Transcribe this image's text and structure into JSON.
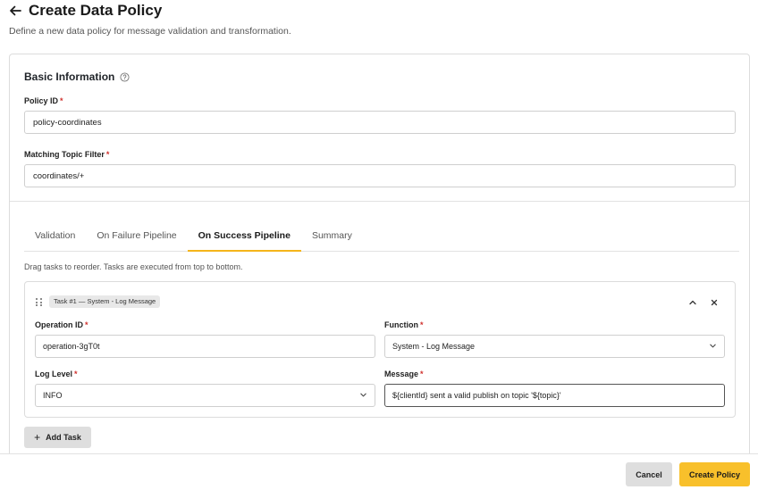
{
  "header": {
    "title": "Create Data Policy",
    "subtitle": "Define a new data policy for message validation and transformation."
  },
  "basic_info": {
    "title": "Basic Information",
    "policy_id_label": "Policy ID",
    "policy_id_value": "policy-coordinates",
    "topic_filter_label": "Matching Topic Filter",
    "topic_filter_value": "coordinates/+",
    "required_mark": "*"
  },
  "tabs": [
    {
      "label": "Validation",
      "active": false
    },
    {
      "label": "On Failure Pipeline",
      "active": false
    },
    {
      "label": "On Success Pipeline",
      "active": true
    },
    {
      "label": "Summary",
      "active": false
    }
  ],
  "pipeline": {
    "hint": "Drag tasks to reorder. Tasks are executed from top to bottom.",
    "task": {
      "badge": "Task #1 — System - Log Message",
      "operation_id_label": "Operation ID",
      "operation_id_value": "operation-3gT0t",
      "function_label": "Function",
      "function_value": "System - Log Message",
      "log_level_label": "Log Level",
      "log_level_value": "INFO",
      "message_label": "Message",
      "message_value": "${clientId} sent a valid publish on topic '${topic}'"
    },
    "add_task_label": "Add Task"
  },
  "footer": {
    "cancel_label": "Cancel",
    "create_label": "Create Policy"
  },
  "colors": {
    "accent": "#f8c02b",
    "required": "#d0312d"
  }
}
